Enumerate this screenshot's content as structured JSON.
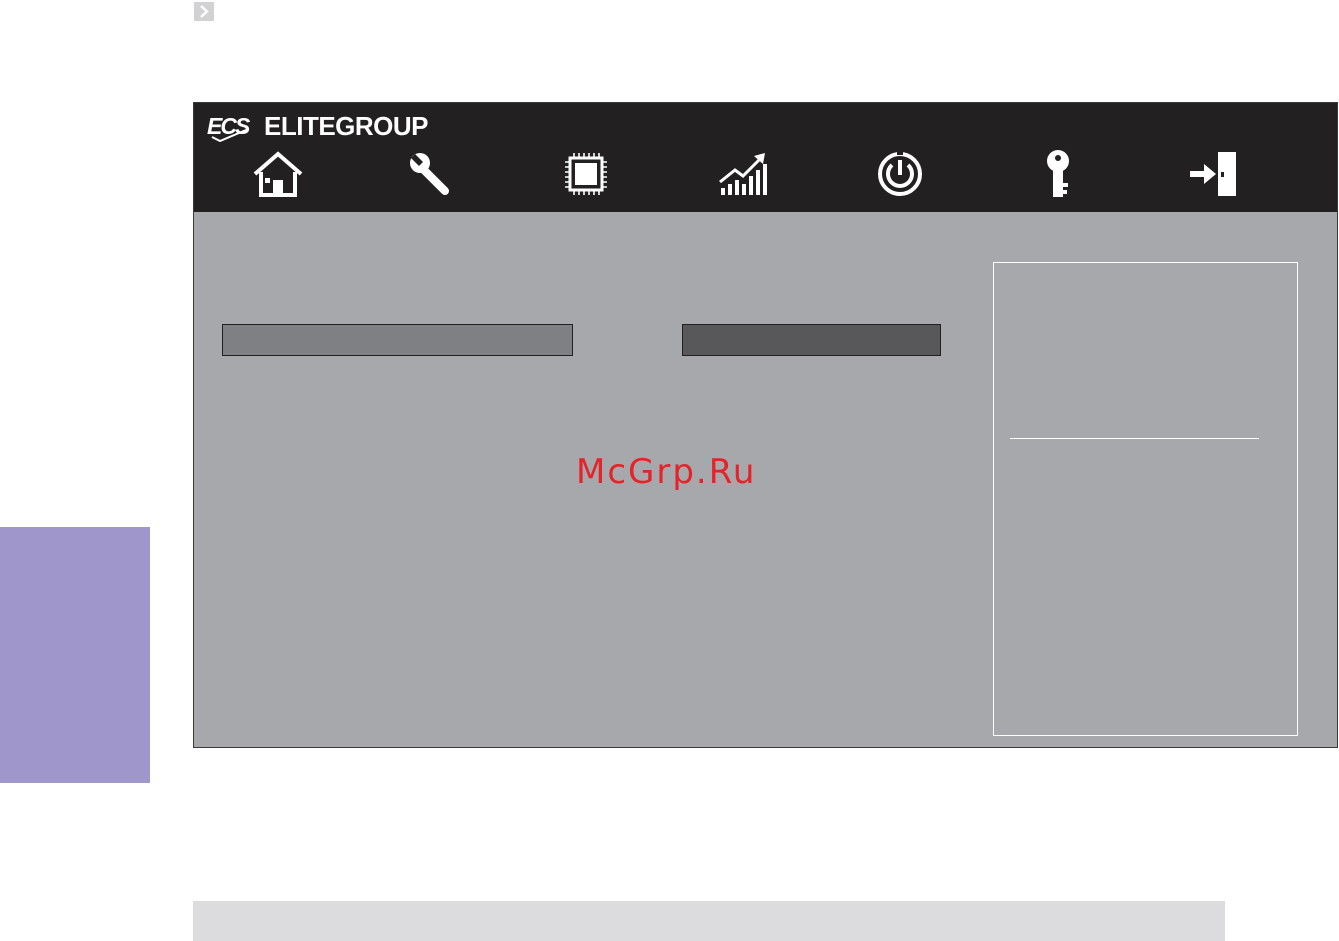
{
  "brand": {
    "name": "ELITEGROUP",
    "logo_text": "ECS"
  },
  "nav_icons": [
    "home-icon",
    "wrench-icon",
    "chip-icon",
    "chart-icon",
    "power-icon",
    "key-icon",
    "exit-icon"
  ],
  "watermark": "McGrp.Ru",
  "colors": {
    "header_bg": "#232021",
    "body_bg": "#a7a8ab",
    "side_tab": "#9f97cc",
    "watermark": "#e4242a"
  }
}
